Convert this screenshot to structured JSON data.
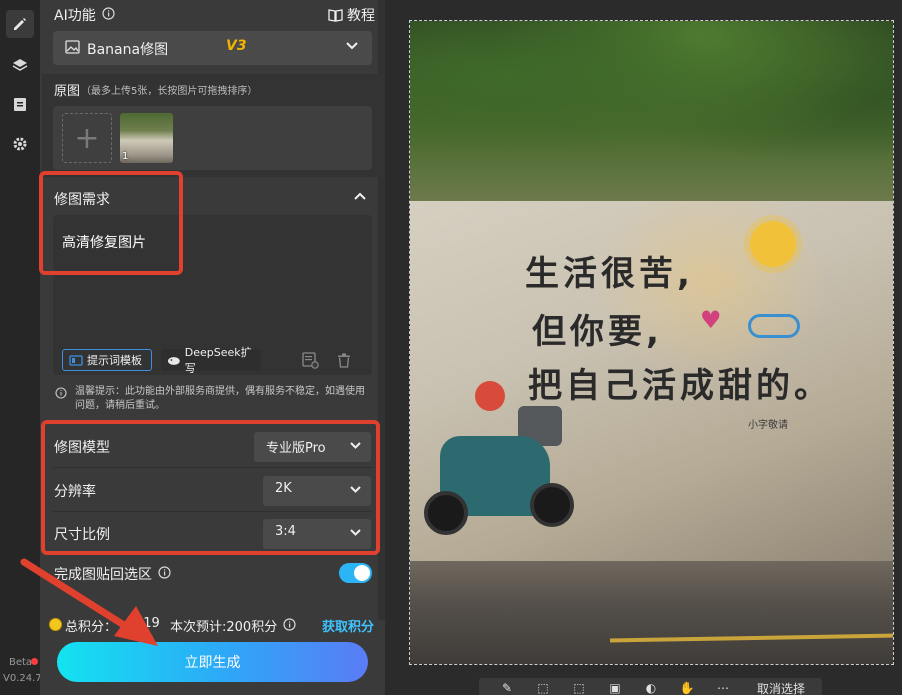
{
  "rail": {
    "beta_label": "Beta",
    "version": "V0.24.7"
  },
  "header": {
    "title": "AI功能",
    "tutorial_label": "教程"
  },
  "model_select": {
    "value": "Banana修图",
    "badge": "V3"
  },
  "original": {
    "label": "原图",
    "hint": "（最多上传5张，长按图片可拖拽排序）",
    "add_symbol": "+",
    "thumbs": [
      {
        "index": "1"
      }
    ]
  },
  "request": {
    "title": "修图需求",
    "text": "高清修复图片",
    "template_button": "提示词模板",
    "deepseek_button": "DeepSeek扩写"
  },
  "notice": {
    "text": "温馨提示：此功能由外部服务商提供，偶有服务不稳定，如遇使用问题，请稍后重试。"
  },
  "settings": {
    "model_label": "修图模型",
    "model_value": "专业版Pro",
    "resolution_label": "分辨率",
    "resolution_value": "2K",
    "ratio_label": "尺寸比例",
    "ratio_value": "3:4"
  },
  "paste": {
    "label": "完成图贴回选区",
    "enabled": true
  },
  "points": {
    "total_label": "总积分：",
    "total_value": "419",
    "estimate": "本次预计:200积分",
    "get_points": "获取积分"
  },
  "generate_button": "立即生成",
  "image": {
    "line1": "生活很苦,",
    "line2": "但你要,",
    "line3": "把自己活成甜的。",
    "small_sign": "小字敬请"
  },
  "toolbar": {
    "cancel_selection": "取消选择"
  },
  "colors": {
    "accent_blue": "#2ea7f7",
    "annotation_red": "#e0402e",
    "badge_yellow": "#f2b400",
    "toggle_on": "#2bb5f5"
  }
}
